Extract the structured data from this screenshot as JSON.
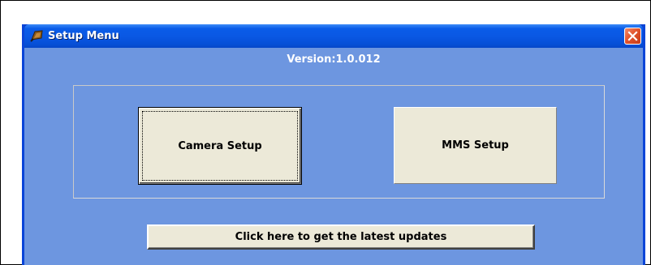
{
  "window": {
    "title": "Setup Menu",
    "icon": "setup-app-icon",
    "close_icon": "close-icon"
  },
  "content": {
    "version": "Version:1.0.012",
    "camera_setup_label": "Camera Setup",
    "mms_setup_label": "MMS Setup",
    "updates_label": "Click here to get the latest updates"
  },
  "colors": {
    "client_background": "#6d96e0",
    "titlebar": "#0a58e4",
    "button_face": "#ece9d8",
    "close_button": "#e2542c"
  }
}
